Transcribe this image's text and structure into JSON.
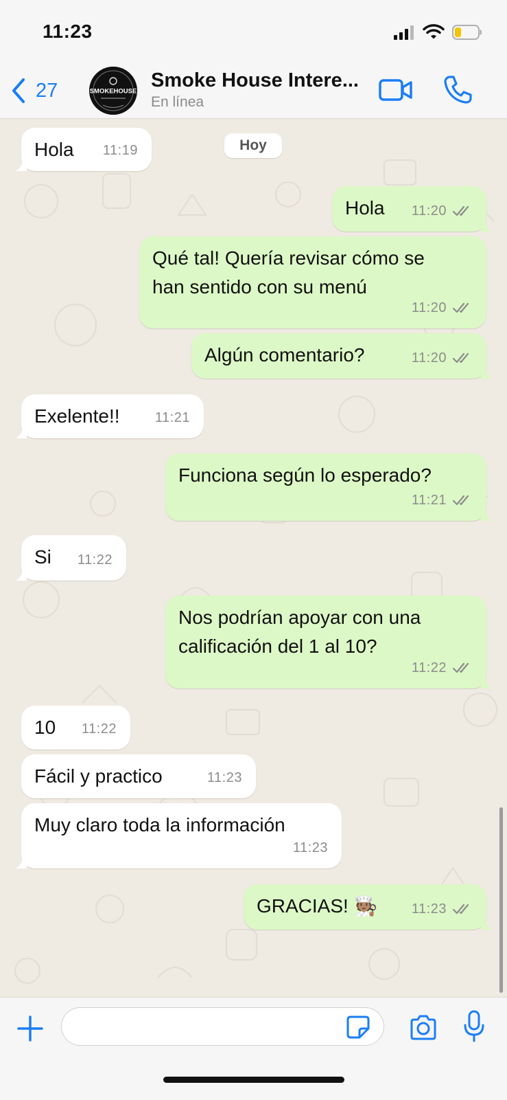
{
  "status_bar": {
    "time": "11:23"
  },
  "header": {
    "back_count": "27",
    "contact_name": "Smoke House Intere...",
    "contact_status": "En línea",
    "avatar_text": "SMOKEHOUSE"
  },
  "chat": {
    "day_label": "Hoy",
    "messages": [
      {
        "dir": "in",
        "text": "Hola",
        "time": "11:19"
      },
      {
        "dir": "out",
        "text": "Hola",
        "time": "11:20",
        "read": true
      },
      {
        "dir": "out",
        "text_lines": [
          "Qué tal! Quería revisar cómo se",
          "han sentido con su menú"
        ],
        "time": "11:20",
        "read": true
      },
      {
        "dir": "out",
        "text": "Algún comentario?",
        "time": "11:20",
        "read": true
      },
      {
        "dir": "in",
        "text": "Exelente!!",
        "time": "11:21"
      },
      {
        "dir": "out",
        "text": "Funciona según lo esperado?",
        "time": "11:21",
        "read": true
      },
      {
        "dir": "in",
        "text": "Si",
        "time": "11:22"
      },
      {
        "dir": "out",
        "text_lines": [
          "Nos podrían apoyar con una",
          "calificación del 1 al 10?"
        ],
        "time": "11:22",
        "read": true
      },
      {
        "dir": "in",
        "text": "10",
        "time": "11:22"
      },
      {
        "dir": "in",
        "text": "Fácil y practico",
        "time": "11:23"
      },
      {
        "dir": "in",
        "text": "Muy claro toda la información",
        "time": "11:23"
      },
      {
        "dir": "out",
        "text": "GRACIAS! 🧑🏽‍🍳",
        "time": "11:23",
        "read": true
      }
    ]
  },
  "composer": {
    "input_value": "",
    "input_placeholder": ""
  },
  "icons": {
    "back": "chevron-left-icon",
    "video_call": "video-camera-icon",
    "voice_call": "phone-icon",
    "attach": "plus-icon",
    "sticker": "sticker-icon",
    "camera": "camera-icon",
    "microphone": "microphone-icon",
    "read_receipt": "double-check-icon"
  },
  "colors": {
    "accent": "#1a7ef5",
    "outgoing_bubble": "#dcf8c6",
    "incoming_bubble": "#ffffff",
    "chat_background": "#efeae2",
    "read_ticks": "#8c8c8c"
  }
}
